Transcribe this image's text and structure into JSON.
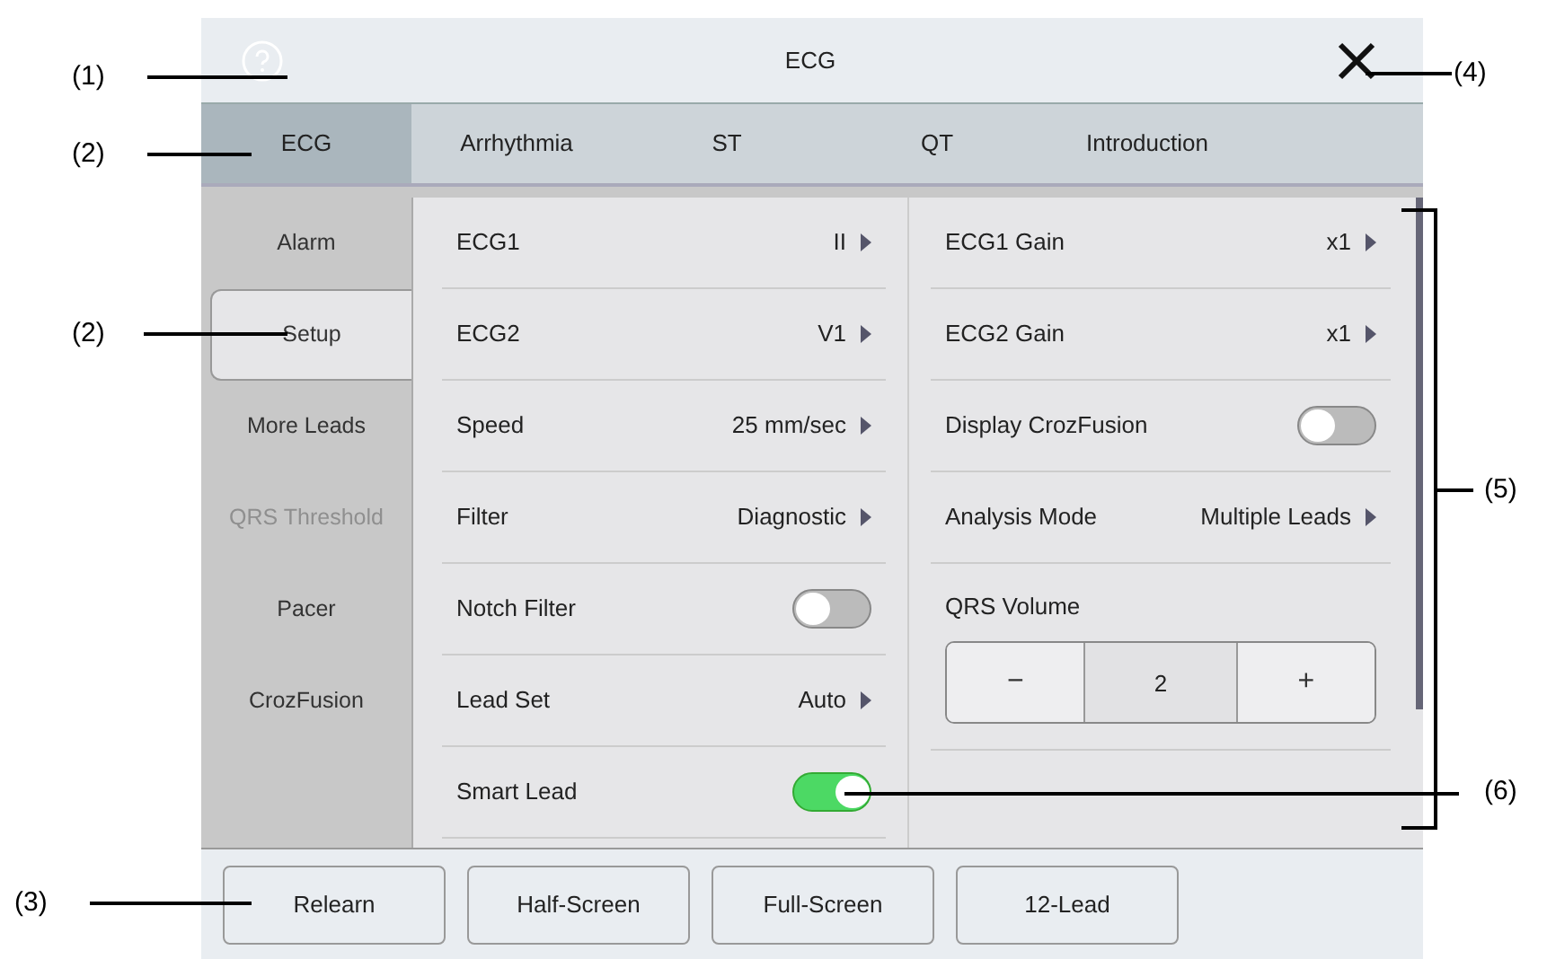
{
  "window": {
    "title": "ECG"
  },
  "tabs": [
    {
      "label": "ECG",
      "selected": true
    },
    {
      "label": "Arrhythmia",
      "selected": false
    },
    {
      "label": "ST",
      "selected": false
    },
    {
      "label": "QT",
      "selected": false
    },
    {
      "label": "Introduction",
      "selected": false
    }
  ],
  "side_menu": [
    {
      "label": "Alarm",
      "selected": false,
      "disabled": false
    },
    {
      "label": "Setup",
      "selected": true,
      "disabled": false
    },
    {
      "label": "More Leads",
      "selected": false,
      "disabled": false
    },
    {
      "label": "QRS Threshold",
      "selected": false,
      "disabled": true
    },
    {
      "label": "Pacer",
      "selected": false,
      "disabled": false
    },
    {
      "label": "CrozFusion",
      "selected": false,
      "disabled": false
    }
  ],
  "settings_left": [
    {
      "kind": "select",
      "label": "ECG1",
      "value": "II"
    },
    {
      "kind": "select",
      "label": "ECG2",
      "value": "V1"
    },
    {
      "kind": "select",
      "label": "Speed",
      "value": "25 mm/sec"
    },
    {
      "kind": "select",
      "label": "Filter",
      "value": "Diagnostic"
    },
    {
      "kind": "toggle",
      "label": "Notch Filter",
      "on": false
    },
    {
      "kind": "select",
      "label": "Lead Set",
      "value": "Auto"
    },
    {
      "kind": "toggle",
      "label": "Smart Lead",
      "on": true
    }
  ],
  "settings_right": [
    {
      "kind": "select",
      "label": "ECG1 Gain",
      "value": "x1"
    },
    {
      "kind": "select",
      "label": "ECG2 Gain",
      "value": "x1"
    },
    {
      "kind": "toggle",
      "label": "Display CrozFusion",
      "on": false
    },
    {
      "kind": "select",
      "label": "Analysis Mode",
      "value": "Multiple Leads"
    },
    {
      "kind": "stepper",
      "label": "QRS Volume",
      "value": "2",
      "minus": "−",
      "plus": "+"
    }
  ],
  "buttons": [
    "Relearn",
    "Half-Screen",
    "Full-Screen",
    "12-Lead"
  ],
  "callouts": [
    "(1)",
    "(2)",
    "(2)",
    "(3)",
    "(4)",
    "(5)",
    "(6)"
  ]
}
